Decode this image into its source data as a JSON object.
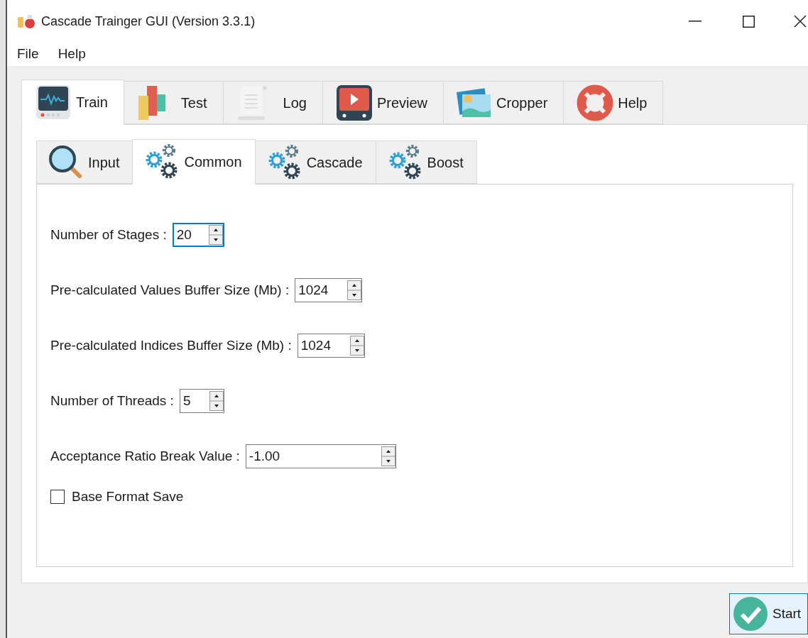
{
  "window": {
    "title": "Cascade Trainger GUI (Version 3.3.1)"
  },
  "menu": [
    "File",
    "Help"
  ],
  "tabs": [
    {
      "label": "Train",
      "kind": "monitor",
      "selected": true
    },
    {
      "label": "Test",
      "kind": "chart",
      "selected": false
    },
    {
      "label": "Log",
      "kind": "document",
      "selected": false
    },
    {
      "label": "Preview",
      "kind": "player",
      "selected": false
    },
    {
      "label": "Cropper",
      "kind": "photo",
      "selected": false
    },
    {
      "label": "Help",
      "kind": "lifebuoy",
      "selected": false
    }
  ],
  "sub_tabs": [
    {
      "label": "Input",
      "kind": "magnifier",
      "selected": false
    },
    {
      "label": "Common",
      "kind": "gears",
      "selected": true
    },
    {
      "label": "Cascade",
      "kind": "gears",
      "selected": false
    },
    {
      "label": "Boost",
      "kind": "gears",
      "selected": false
    }
  ],
  "fields": [
    {
      "label": "Number of Stages :",
      "value": "20",
      "focused": true
    },
    {
      "label": "Pre-calculated Values Buffer Size (Mb) :",
      "value": "1024",
      "focused": false
    },
    {
      "label": "Pre-calculated Indices Buffer Size (Mb) :",
      "value": "1024",
      "focused": false
    },
    {
      "label": "Number of Threads :",
      "value": "5",
      "focused": false
    },
    {
      "label": "Acceptance Ratio Break Value :",
      "value": "-1.00",
      "focused": false
    }
  ],
  "checkbox": {
    "label": "Base Format Save",
    "checked": false
  },
  "start_button": {
    "label": "Start"
  }
}
